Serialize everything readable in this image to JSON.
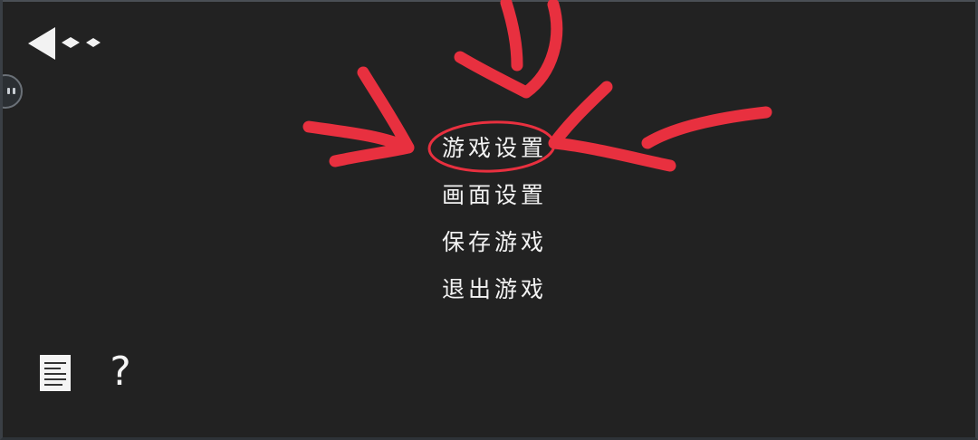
{
  "menu": {
    "items": [
      {
        "label": "游戏设置",
        "highlighted": true
      },
      {
        "label": "画面设置",
        "highlighted": false
      },
      {
        "label": "保存游戏",
        "highlighted": false
      },
      {
        "label": "退出游戏",
        "highlighted": false
      }
    ]
  },
  "toolbar": {
    "back_icon": "back-triangle-icon",
    "help_label": "?",
    "document_icon": "document-icon"
  },
  "colors": {
    "background": "#222222",
    "text": "#f2f2f2",
    "annotation": "#e8303f"
  }
}
